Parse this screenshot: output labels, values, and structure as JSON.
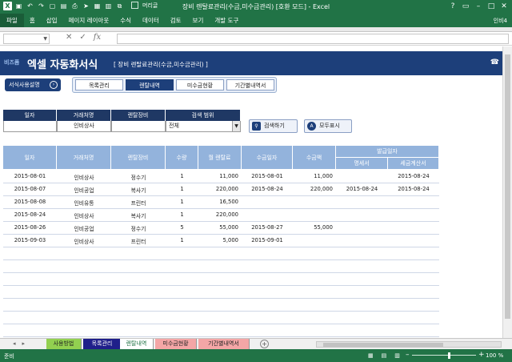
{
  "window": {
    "title": "장비 렌탈료관리(수금,미수금관리) [호환 모드] - Excel",
    "qat_label": "머리글",
    "user": "인비4"
  },
  "ribbon": {
    "tabs": [
      "파일",
      "홈",
      "삽입",
      "페이지 레이아웃",
      "수식",
      "데이터",
      "검토",
      "보기",
      "개발 도구"
    ]
  },
  "formula_bar": {
    "name_box": "",
    "fx": "fx",
    "content": ""
  },
  "banner": {
    "brand": "비즈폼",
    "title": "엑셀 자동화서식",
    "subtitle": "[ 장비 렌탈료관리(수금,미수금관리) ]",
    "phone_icon": "phone-icon"
  },
  "help_button": "서식사용설명",
  "nav_tabs": [
    {
      "label": "목록관리",
      "active": false
    },
    {
      "label": "렌탈내역",
      "active": true
    },
    {
      "label": "미수금현황",
      "active": false
    },
    {
      "label": "기간별내역서",
      "active": false
    }
  ],
  "search": {
    "headers": [
      "일자",
      "거래처명",
      "렌탈장비",
      "검색 범위"
    ],
    "values": [
      "",
      "인비상사",
      "",
      "전체"
    ],
    "search_button": "검색하기",
    "show_all_button": "모두표시"
  },
  "table": {
    "headers": [
      "일자",
      "거래처명",
      "렌탈장비",
      "수량",
      "월 렌탈료",
      "수금일자",
      "수금액",
      "발급일자"
    ],
    "subheaders": [
      "명세서",
      "세금계산서"
    ],
    "rows": [
      [
        "2015-08-01",
        "인비상사",
        "정수기",
        "1",
        "11,000",
        "2015-08-01",
        "11,000",
        "",
        "2015-08-24"
      ],
      [
        "2015-08-07",
        "인비공업",
        "복사기",
        "1",
        "220,000",
        "2015-08-24",
        "220,000",
        "2015-08-24",
        "2015-08-24"
      ],
      [
        "2015-08-08",
        "인비유통",
        "프린터",
        "1",
        "16,500",
        "",
        "",
        "",
        ""
      ],
      [
        "2015-08-24",
        "인비상사",
        "복사기",
        "1",
        "220,000",
        "",
        "",
        "",
        ""
      ],
      [
        "2015-08-26",
        "인비공업",
        "정수기",
        "5",
        "55,000",
        "2015-08-27",
        "55,000",
        "",
        ""
      ],
      [
        "2015-09-03",
        "인비상사",
        "프린터",
        "1",
        "5,000",
        "2015-09-01",
        "",
        "",
        ""
      ]
    ]
  },
  "sheet_tabs": [
    {
      "label": "사용방법",
      "bg": "#92d050",
      "fg": "#222222"
    },
    {
      "label": "목록관리",
      "bg": "#1f1f8a",
      "fg": "#ffffff"
    },
    {
      "label": "렌탈내역",
      "bg": "#ffffff",
      "fg": "#217346"
    },
    {
      "label": "미수금현황",
      "bg": "#f4a6a6",
      "fg": "#222222"
    },
    {
      "label": "기간별내역서",
      "bg": "#f4a6a6",
      "fg": "#222222"
    }
  ],
  "status": {
    "ready": "준비",
    "zoom": "100 %"
  },
  "colors": {
    "excel_green": "#217346",
    "banner_navy": "#1d3f7a",
    "header_blue": "#93b3dc",
    "search_header": "#1f3864"
  }
}
